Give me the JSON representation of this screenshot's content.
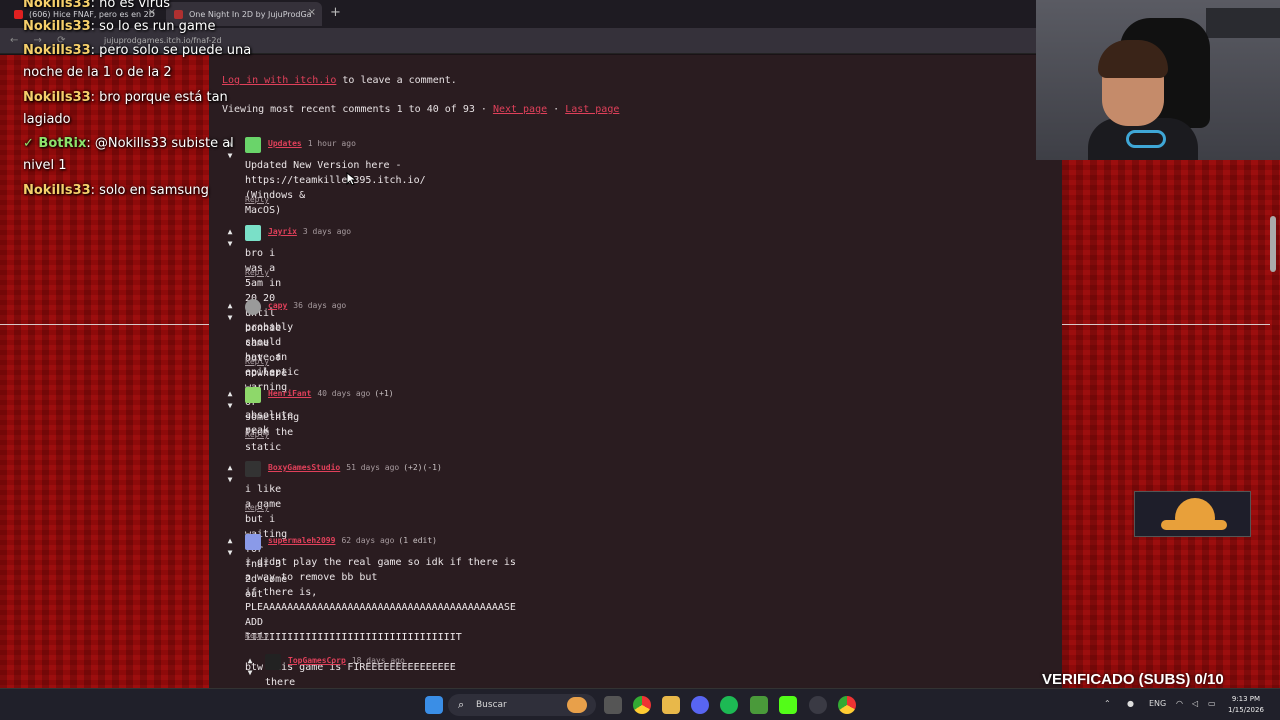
{
  "browser": {
    "tabs": [
      {
        "title": "(606) Hice FNAF, pero es en 2D",
        "active": false,
        "favicon_color": "#e02020"
      },
      {
        "title": "One Night In 2D by JujuProdGa",
        "active": true,
        "favicon_color": "#b03030"
      }
    ],
    "new_tab_label": "+",
    "close_label": "×",
    "url": "jujuprodgames.itch.io/fnaf-2d"
  },
  "comments_section": {
    "login_link": "Log in with itch.io",
    "login_suffix": " to leave a comment.",
    "viewing_text": "Viewing most recent comments 1 to 40 of 93 · ",
    "next_page": "Next page",
    "separator": " · ",
    "last_page": "Last page",
    "comments": [
      {
        "user": "Updates",
        "time": "1 hour ago",
        "extra": "",
        "avatar_color": "#6ad46a",
        "body": "Updated New Version here - https://teamkiller395.itch.io/ (Windows &\nMacOS)",
        "reply": "Reply"
      },
      {
        "user": "Jayrix",
        "time": "3 days ago",
        "extra": "",
        "avatar_color": "#7ae0c8",
        "body": "bro i was a 5am in 20 20 until bonnie came out of nowhare",
        "reply": "Reply"
      },
      {
        "user": "capy",
        "time": "36 days ago",
        "extra": "",
        "avatar_color": "#9a9a9a",
        "body": "probably should have an epileptic warning or something from the\nstatic",
        "reply": "Reply"
      },
      {
        "user": "HenriFant",
        "time": "40 days ago",
        "extra": "(+1)",
        "avatar_color": "#8ed86a",
        "body": "absolute peak",
        "reply": "Reply"
      },
      {
        "user": "BoxyGamesStudio",
        "time": "51 days ago",
        "extra": "(+2)(-1)",
        "avatar_color": "#333333",
        "body": "i like a game but i waiting for fnaf 3 2d come out",
        "reply": "Reply"
      },
      {
        "user": "supermaleh2099",
        "time": "62 days ago",
        "extra": "(1 edit)",
        "avatar_color": "#8a9ae8",
        "body": "i didnt play the real game so idk if there is a way to remove bb but\nif there is, PLEAAAAAAAAAAAAAAAAAAAAAAAAAAAAAAAAAAAAAAAASE ADD\nIIIIIIIIIIIIIIIIIIIIIIIIIIIIIIIIIIIT\n\nbtw this game is FIREEEEEEEEEEEEEEE",
        "reply": "Reply"
      }
    ],
    "nested_reply": {
      "user": "TopGamesCorp",
      "time": "18 days ago",
      "avatar_color": "#222222",
      "body": "there is no way to remove the bb"
    }
  },
  "chat": {
    "messages": [
      {
        "name": "Nokills33",
        "text": ": no es virus"
      },
      {
        "name": "Nokills33",
        "text": ": so lo es run game"
      },
      {
        "name": "Nokills33",
        "text": ": pero solo se puede una"
      },
      {
        "name": "",
        "text": "noche de la 1 o de la 2"
      },
      {
        "name": "Nokills33",
        "text": ": bro porque está tan"
      },
      {
        "name": "",
        "text": "lagiado"
      },
      {
        "name": "BotRix",
        "text": ": @Nokills33 subiste al",
        "bot": true
      },
      {
        "name": "",
        "text": "nivel 1"
      },
      {
        "name": "Nokills33",
        "text": ": solo en samsung"
      }
    ]
  },
  "overlay": {
    "verified_text": "VERIFICADO (SUBS) 0/10"
  },
  "taskbar": {
    "search_placeholder": "Buscar",
    "lang": "ENG",
    "time": "9:13 PM",
    "date": "1/15/2026"
  }
}
